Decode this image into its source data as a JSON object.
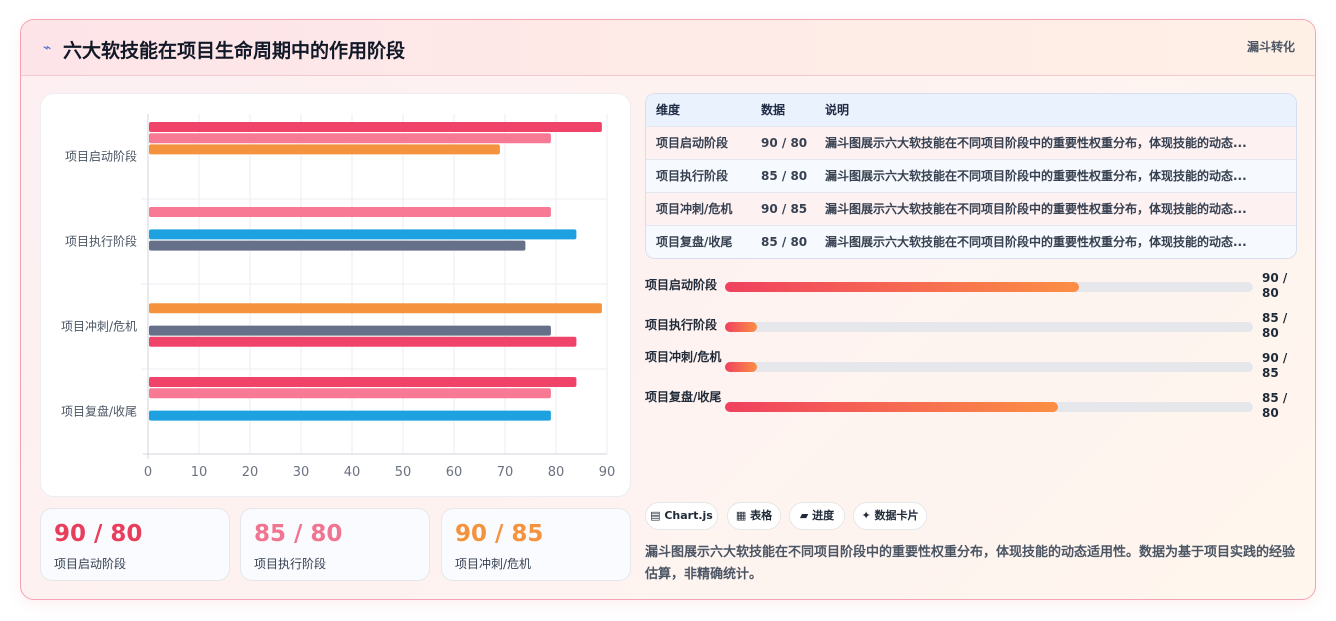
{
  "header": {
    "icon": "lightning-icon",
    "title": "六大软技能在项目生命周期中的作用阶段",
    "tag": "漏斗转化"
  },
  "chart_data": {
    "type": "bar",
    "orientation": "horizontal",
    "categories": [
      "项目启动阶段",
      "项目执行阶段",
      "项目冲刺/危机",
      "项目复盘/收尾"
    ],
    "xlim": [
      0,
      90
    ],
    "xticks": [
      "0",
      "10",
      "20",
      "30",
      "40",
      "50",
      "60",
      "70",
      "80",
      "90"
    ],
    "grid": true,
    "bars": [
      [
        {
          "value": 89,
          "color": "#f0436a"
        },
        {
          "value": 79,
          "color": "#f87993"
        },
        {
          "value": 69,
          "color": "#f4923d"
        }
      ],
      [
        {
          "value": 79,
          "color": "#f87993"
        },
        null,
        {
          "value": 84,
          "color": "#1da1e0"
        },
        {
          "value": 74,
          "color": "#667089"
        }
      ],
      [
        null,
        {
          "value": 89,
          "color": "#f4923d"
        },
        null,
        {
          "value": 79,
          "color": "#667089"
        },
        {
          "value": 84,
          "color": "#f0436a"
        }
      ],
      [
        {
          "value": 84,
          "color": "#f0436a"
        },
        {
          "value": 79,
          "color": "#f87993"
        },
        null,
        {
          "value": 79,
          "color": "#1da1e0"
        }
      ]
    ]
  },
  "kpis": [
    {
      "value": "90 / 80",
      "label": "项目启动阶段",
      "color": "#e83e5c"
    },
    {
      "value": "85 / 80",
      "label": "项目执行阶段",
      "color": "#f07590"
    },
    {
      "value": "90 / 85",
      "label": "项目冲刺/危机",
      "color": "#f4923d"
    }
  ],
  "table": {
    "headers": [
      "维度",
      "数据",
      "说明"
    ],
    "rows": [
      [
        "项目启动阶段",
        "90 / 80",
        "漏斗图展示六大软技能在不同项目阶段中的重要性权重分布，体现技能的动态..."
      ],
      [
        "项目执行阶段",
        "85 / 80",
        "漏斗图展示六大软技能在不同项目阶段中的重要性权重分布，体现技能的动态..."
      ],
      [
        "项目冲刺/危机",
        "90 / 85",
        "漏斗图展示六大软技能在不同项目阶段中的重要性权重分布，体现技能的动态..."
      ],
      [
        "项目复盘/收尾",
        "85 / 80",
        "漏斗图展示六大软技能在不同项目阶段中的重要性权重分布，体现技能的动态..."
      ]
    ]
  },
  "progress": [
    {
      "label": "项目启动阶段",
      "val_line1": "90 /",
      "val_line2": "80",
      "fraction": 0.67
    },
    {
      "label": "项目执行阶段",
      "val_line1": "85 /",
      "val_line2": "80",
      "fraction": 0.06
    },
    {
      "label": "项目冲刺/危机",
      "val_line1": "90 /",
      "val_line2": "85",
      "fraction": 0.06
    },
    {
      "label": "项目复盘/收尾",
      "val_line1": "85 /",
      "val_line2": "80",
      "fraction": 0.63
    }
  ],
  "chips": [
    "▤ Chart.js",
    "▦ 表格",
    "▰ 进度",
    "✦ 数据卡片"
  ],
  "note": "漏斗图展示六大软技能在不同项目阶段中的重要性权重分布，体现技能的动态适用性。数据为基于项目实践的经验估算，非精确统计。"
}
